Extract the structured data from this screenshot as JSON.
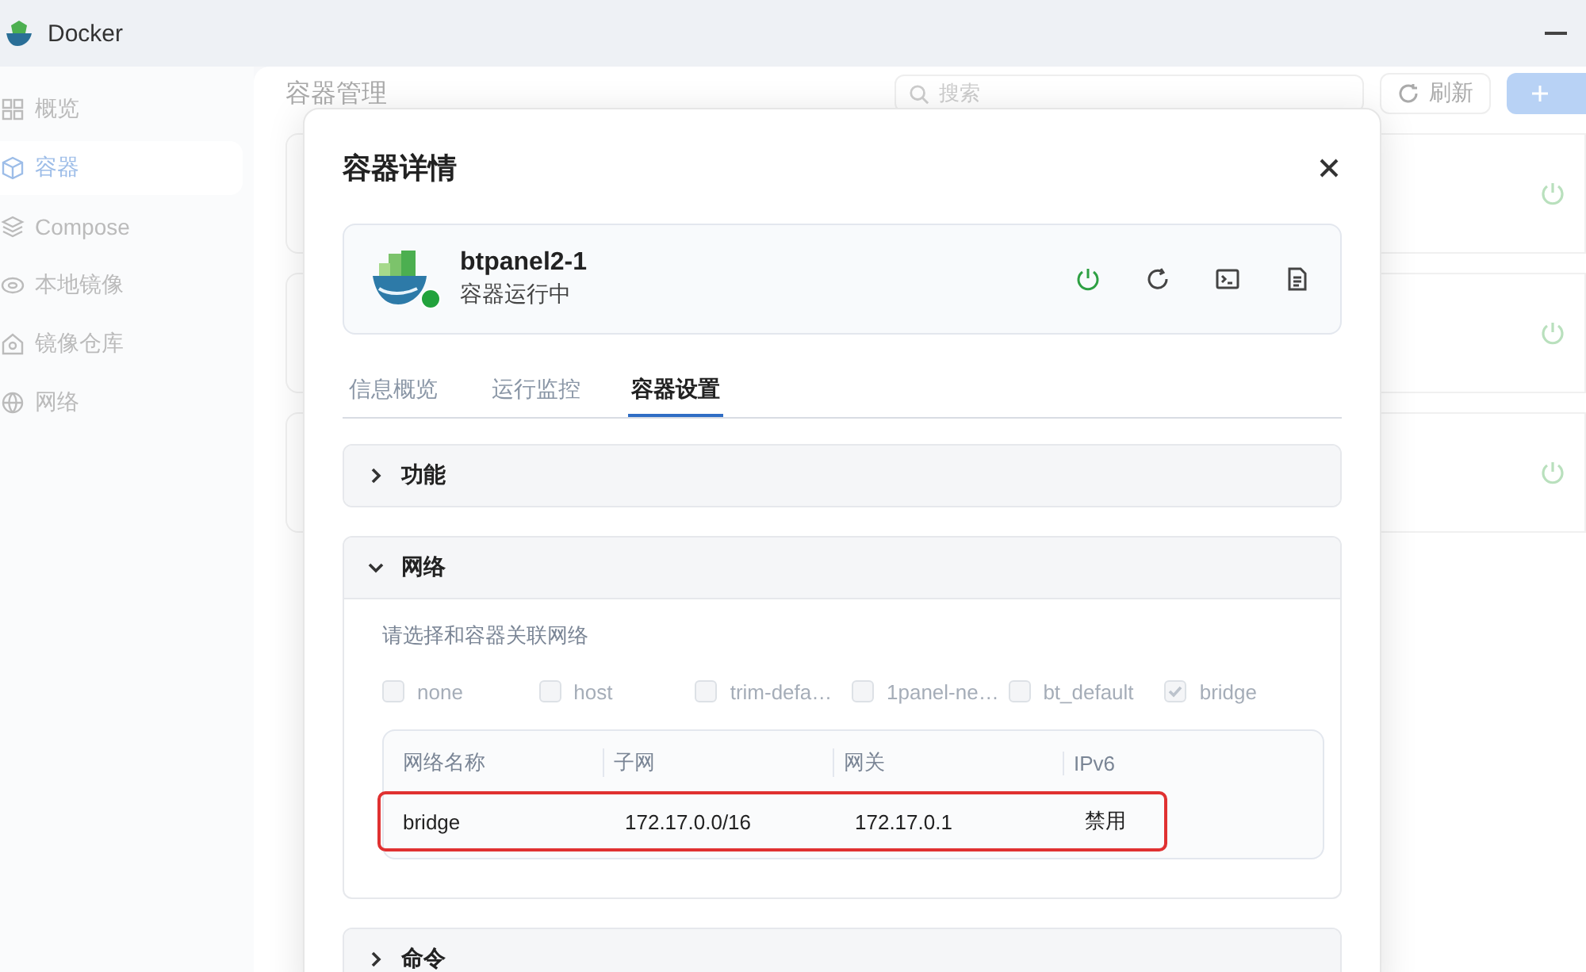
{
  "window": {
    "title": "Docker"
  },
  "sidebar": {
    "items": [
      {
        "label": "概览",
        "selected": false
      },
      {
        "label": "容器",
        "selected": true
      },
      {
        "label": "Compose",
        "selected": false
      },
      {
        "label": "本地镜像",
        "selected": false
      },
      {
        "label": "镜像仓库",
        "selected": false
      },
      {
        "label": "网络",
        "selected": false
      }
    ]
  },
  "page": {
    "title": "容器管理",
    "search": {
      "placeholder": "搜索"
    },
    "refresh_button": "刷新"
  },
  "dialog": {
    "title": "容器详情",
    "container": {
      "name": "btpanel2-1",
      "status": "容器运行中",
      "running": true
    },
    "tabs": [
      {
        "label": "信息概览",
        "selected": false
      },
      {
        "label": "运行监控",
        "selected": false
      },
      {
        "label": "容器设置",
        "selected": true
      }
    ],
    "sections": [
      {
        "title": "功能",
        "expanded": false
      },
      {
        "title": "网络",
        "expanded": true,
        "hint": "请选择和容器关联网络",
        "networks": [
          {
            "label": "none",
            "checked": false,
            "disabled": true
          },
          {
            "label": "host",
            "checked": false,
            "disabled": true
          },
          {
            "label": "trim-defa…",
            "checked": false,
            "disabled": true
          },
          {
            "label": "1panel-ne…",
            "checked": false,
            "disabled": true
          },
          {
            "label": "bt_default",
            "checked": false,
            "disabled": true
          },
          {
            "label": "bridge",
            "checked": true,
            "disabled": true
          }
        ],
        "table": {
          "columns": [
            "网络名称",
            "子网",
            "网关",
            "IPv6"
          ],
          "rows": [
            {
              "cells": [
                "bridge",
                "172.17.0.0/16",
                "172.17.0.1",
                "禁用"
              ],
              "highlighted": true
            }
          ]
        }
      },
      {
        "title": "命令",
        "expanded": false
      }
    ]
  }
}
